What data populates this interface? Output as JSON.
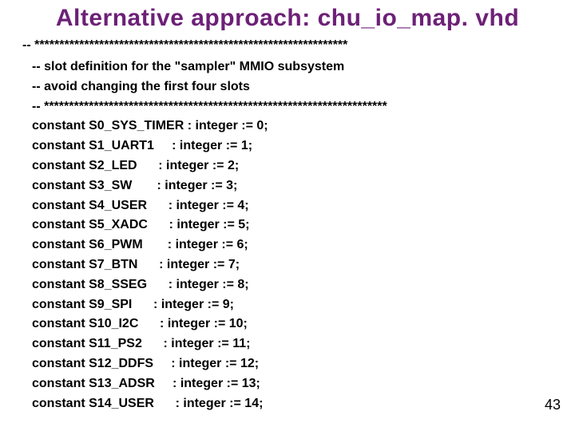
{
  "title": "Alternative approach: chu_io_map. vhd",
  "rule_top": "-- ***************************************************************",
  "comment1": "-- slot definition for the \"sampler\" MMIO subsystem",
  "comment2": "-- avoid changing the first four slots",
  "rule_mid": "-- *********************************************************************",
  "constants": [
    "constant S0_SYS_TIMER : integer := 0;",
    "constant S1_UART1     : integer := 1;",
    "constant S2_LED      : integer := 2;",
    "constant S3_SW       : integer := 3;",
    "constant S4_USER      : integer := 4;",
    "constant S5_XADC      : integer := 5;",
    "constant S6_PWM       : integer := 6;",
    "constant S7_BTN      : integer := 7;",
    "constant S8_SSEG      : integer := 8;",
    "constant S9_SPI      : integer := 9;",
    "constant S10_I2C      : integer := 10;",
    "constant S11_PS2      : integer := 11;",
    "constant S12_DDFS     : integer := 12;",
    "constant S13_ADSR     : integer := 13;",
    "constant S14_USER      : integer := 14;"
  ],
  "page_num": "43"
}
